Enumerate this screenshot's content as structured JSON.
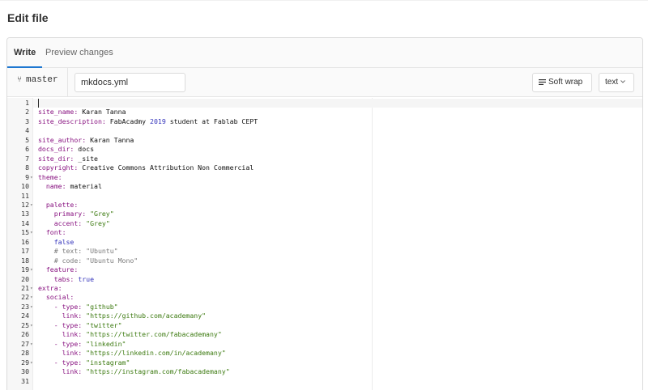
{
  "page": {
    "title": "Edit file"
  },
  "tabs": {
    "write": "Write",
    "preview": "Preview changes"
  },
  "toolbar": {
    "branch_icon": "fork-icon",
    "branch": "master",
    "filename": "mkdocs.yml",
    "soft_wrap": "Soft wrap",
    "mode": "text"
  },
  "lines": [
    {
      "n": "1",
      "fold": false,
      "parts": []
    },
    {
      "n": "2",
      "fold": false,
      "parts": [
        [
          "k",
          "site_name:"
        ],
        [
          "t",
          " Karan Tanna"
        ]
      ]
    },
    {
      "n": "3",
      "fold": false,
      "parts": [
        [
          "k",
          "site_description:"
        ],
        [
          "t",
          " FabAcadmy "
        ],
        [
          "n",
          "2019"
        ],
        [
          "t",
          " student at Fablab CEPT"
        ]
      ]
    },
    {
      "n": "4",
      "fold": false,
      "parts": []
    },
    {
      "n": "5",
      "fold": false,
      "parts": [
        [
          "k",
          "site_author:"
        ],
        [
          "t",
          " Karan Tanna"
        ]
      ]
    },
    {
      "n": "6",
      "fold": false,
      "parts": [
        [
          "k",
          "docs_dir:"
        ],
        [
          "t",
          " docs"
        ]
      ]
    },
    {
      "n": "7",
      "fold": false,
      "parts": [
        [
          "k",
          "site_dir:"
        ],
        [
          "t",
          " _site"
        ]
      ]
    },
    {
      "n": "8",
      "fold": false,
      "parts": [
        [
          "k",
          "copyright:"
        ],
        [
          "t",
          " Creative Commons Attribution Non Commercial"
        ]
      ]
    },
    {
      "n": "9",
      "fold": true,
      "parts": [
        [
          "k",
          "theme:"
        ]
      ]
    },
    {
      "n": "10",
      "fold": false,
      "parts": [
        [
          "t",
          "  "
        ],
        [
          "k",
          "name:"
        ],
        [
          "t",
          " material"
        ]
      ]
    },
    {
      "n": "11",
      "fold": false,
      "parts": []
    },
    {
      "n": "12",
      "fold": true,
      "parts": [
        [
          "t",
          "  "
        ],
        [
          "k",
          "palette:"
        ]
      ]
    },
    {
      "n": "13",
      "fold": false,
      "parts": [
        [
          "t",
          "    "
        ],
        [
          "k",
          "primary:"
        ],
        [
          "t",
          " "
        ],
        [
          "s2",
          "\"Grey\""
        ]
      ]
    },
    {
      "n": "14",
      "fold": false,
      "parts": [
        [
          "t",
          "    "
        ],
        [
          "k",
          "accent:"
        ],
        [
          "t",
          " "
        ],
        [
          "s2",
          "\"Grey\""
        ]
      ]
    },
    {
      "n": "15",
      "fold": true,
      "parts": [
        [
          "t",
          "  "
        ],
        [
          "k",
          "font:"
        ]
      ]
    },
    {
      "n": "16",
      "fold": false,
      "parts": [
        [
          "t",
          "    "
        ],
        [
          "b",
          "false"
        ]
      ]
    },
    {
      "n": "17",
      "fold": false,
      "parts": [
        [
          "t",
          "    "
        ],
        [
          "c",
          "# text: \"Ubuntu\""
        ]
      ]
    },
    {
      "n": "18",
      "fold": false,
      "parts": [
        [
          "t",
          "    "
        ],
        [
          "c",
          "# code: \"Ubuntu Mono\""
        ]
      ]
    },
    {
      "n": "19",
      "fold": true,
      "parts": [
        [
          "t",
          "  "
        ],
        [
          "k",
          "feature:"
        ]
      ]
    },
    {
      "n": "20",
      "fold": false,
      "parts": [
        [
          "t",
          "    "
        ],
        [
          "k",
          "tabs:"
        ],
        [
          "t",
          " "
        ],
        [
          "b",
          "true"
        ]
      ]
    },
    {
      "n": "21",
      "fold": true,
      "parts": [
        [
          "k",
          "extra:"
        ]
      ]
    },
    {
      "n": "22",
      "fold": true,
      "parts": [
        [
          "t",
          "  "
        ],
        [
          "k",
          "social:"
        ]
      ]
    },
    {
      "n": "23",
      "fold": true,
      "parts": [
        [
          "t",
          "    "
        ],
        [
          "k",
          "- type:"
        ],
        [
          "t",
          " "
        ],
        [
          "s2",
          "\"github\""
        ]
      ]
    },
    {
      "n": "24",
      "fold": false,
      "parts": [
        [
          "t",
          "      "
        ],
        [
          "k",
          "link:"
        ],
        [
          "t",
          " "
        ],
        [
          "s2",
          "\"https://github.com/academany\""
        ]
      ]
    },
    {
      "n": "25",
      "fold": true,
      "parts": [
        [
          "t",
          "    "
        ],
        [
          "k",
          "- type:"
        ],
        [
          "t",
          " "
        ],
        [
          "s2",
          "\"twitter\""
        ]
      ]
    },
    {
      "n": "26",
      "fold": false,
      "parts": [
        [
          "t",
          "      "
        ],
        [
          "k",
          "link:"
        ],
        [
          "t",
          " "
        ],
        [
          "s2",
          "\"https://twitter.com/fabacademany\""
        ]
      ]
    },
    {
      "n": "27",
      "fold": true,
      "parts": [
        [
          "t",
          "    "
        ],
        [
          "k",
          "- type:"
        ],
        [
          "t",
          " "
        ],
        [
          "s2",
          "\"linkedin\""
        ]
      ]
    },
    {
      "n": "28",
      "fold": false,
      "parts": [
        [
          "t",
          "      "
        ],
        [
          "k",
          "link:"
        ],
        [
          "t",
          " "
        ],
        [
          "s2",
          "\"https://linkedin.com/in/academany\""
        ]
      ]
    },
    {
      "n": "29",
      "fold": true,
      "parts": [
        [
          "t",
          "    "
        ],
        [
          "k",
          "- type:"
        ],
        [
          "t",
          " "
        ],
        [
          "s2",
          "\"instagram\""
        ]
      ]
    },
    {
      "n": "30",
      "fold": false,
      "parts": [
        [
          "t",
          "      "
        ],
        [
          "k",
          "link:"
        ],
        [
          "t",
          " "
        ],
        [
          "s2",
          "\"https://instagram.com/fabacademany\""
        ]
      ]
    },
    {
      "n": "31",
      "fold": false,
      "parts": []
    }
  ]
}
